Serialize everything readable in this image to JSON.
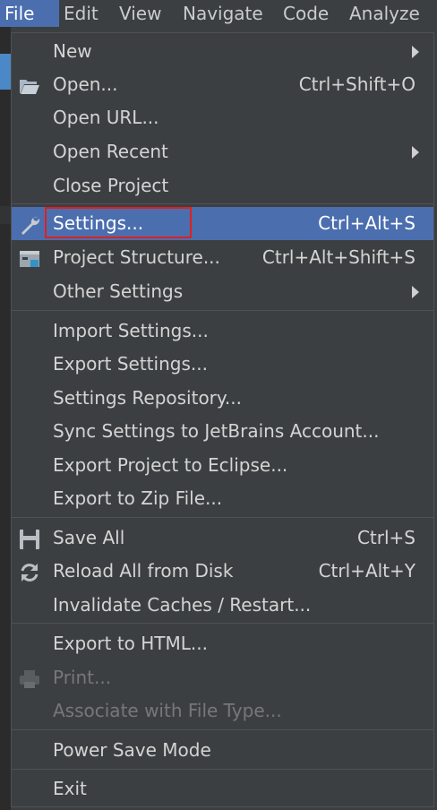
{
  "menubar": {
    "items": [
      {
        "label": "File",
        "active": true
      },
      {
        "label": "Edit",
        "active": false
      },
      {
        "label": "View",
        "active": false
      },
      {
        "label": "Navigate",
        "active": false
      },
      {
        "label": "Code",
        "active": false
      },
      {
        "label": "Analyze",
        "active": false
      }
    ]
  },
  "file_menu": {
    "new": {
      "label": "New",
      "submenu": true
    },
    "open": {
      "label": "Open...",
      "shortcut": "Ctrl+Shift+O",
      "icon": "folder-open-icon"
    },
    "open_url": {
      "label": "Open URL..."
    },
    "open_recent": {
      "label": "Open Recent",
      "submenu": true
    },
    "close_project": {
      "label": "Close Project"
    },
    "settings": {
      "label": "Settings...",
      "shortcut": "Ctrl+Alt+S",
      "icon": "wrench-icon",
      "selected": true
    },
    "project_structure": {
      "label": "Project Structure...",
      "shortcut": "Ctrl+Alt+Shift+S",
      "icon": "project-structure-icon"
    },
    "other_settings": {
      "label": "Other Settings",
      "submenu": true
    },
    "import_settings": {
      "label": "Import Settings..."
    },
    "export_settings": {
      "label": "Export Settings..."
    },
    "settings_repository": {
      "label": "Settings Repository..."
    },
    "sync_settings": {
      "label": "Sync Settings to JetBrains Account..."
    },
    "export_eclipse": {
      "label": "Export Project to Eclipse..."
    },
    "export_zip": {
      "label": "Export to Zip File..."
    },
    "save_all": {
      "label": "Save All",
      "shortcut": "Ctrl+S",
      "icon": "save-icon"
    },
    "reload_disk": {
      "label": "Reload All from Disk",
      "shortcut": "Ctrl+Alt+Y",
      "icon": "reload-icon"
    },
    "invalidate_caches": {
      "label": "Invalidate Caches / Restart..."
    },
    "export_html": {
      "label": "Export to HTML..."
    },
    "print": {
      "label": "Print...",
      "icon": "printer-icon",
      "disabled": true
    },
    "associate_file_type": {
      "label": "Associate with File Type...",
      "disabled": true
    },
    "power_save": {
      "label": "Power Save Mode"
    },
    "exit": {
      "label": "Exit"
    }
  },
  "colors": {
    "menu_bg": "#3c3f41",
    "selection": "#4b6eaf",
    "highlight_box": "#e0201d",
    "text": "#d4d4d4",
    "disabled_text": "#777777"
  }
}
